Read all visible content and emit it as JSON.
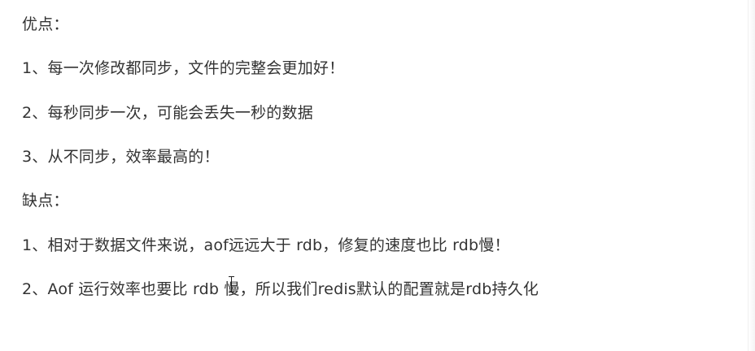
{
  "content": {
    "pros_heading": "优点：",
    "pros": [
      "1、每一次修改都同步，文件的完整会更加好！",
      "2、每秒同步一次，可能会丢失一秒的数据",
      "3、从不同步，效率最高的！"
    ],
    "cons_heading": "缺点：",
    "cons": [
      "1、相对于数据文件来说，aof远远大于 rdb，修复的速度也比 rdb慢！",
      "2、Aof 运行效率也要比 rdb 慢，所以我们redis默认的配置就是rdb持久化"
    ]
  },
  "colors": {
    "text": "#333333",
    "background": "#ffffff"
  },
  "icons": {
    "cursor": "text-cursor-icon"
  }
}
